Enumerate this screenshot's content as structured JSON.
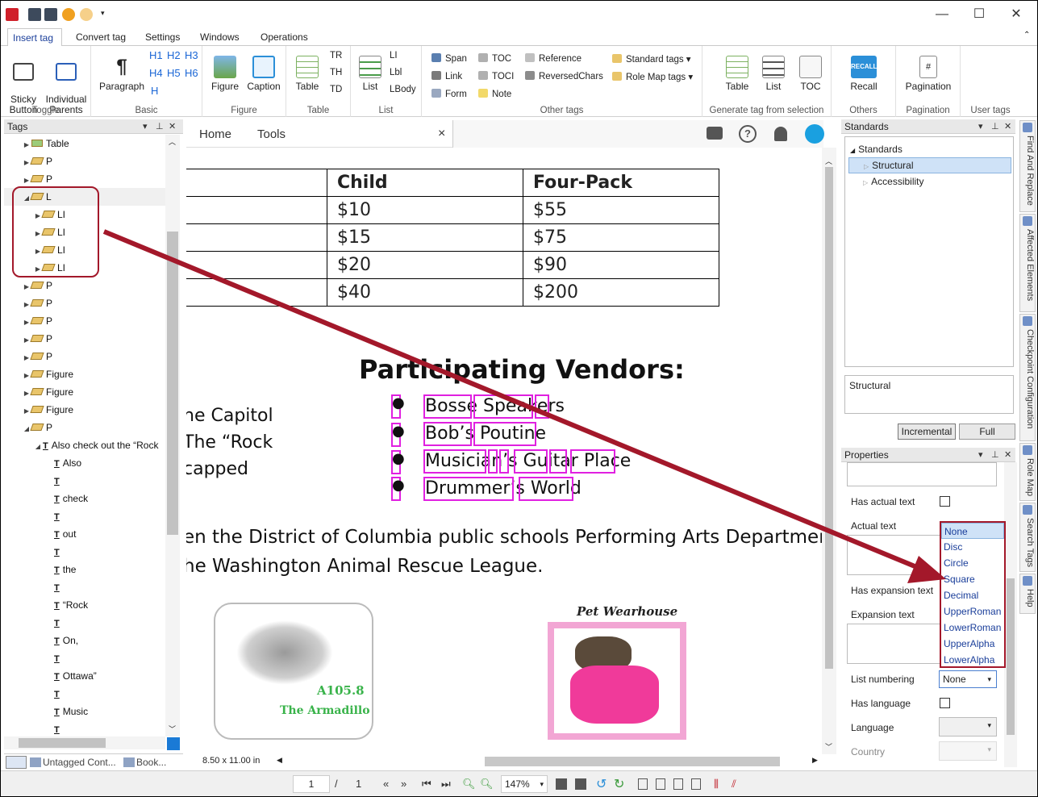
{
  "qat": {
    "app_icon": "pdf-app-icon",
    "icons": [
      "save-icon",
      "save-all-icon",
      "undo-icon",
      "redo-icon"
    ]
  },
  "window": {
    "minimize": "—",
    "maximize": "☐",
    "close": "✕"
  },
  "tabs": [
    "Insert tag",
    "Convert tag",
    "Settings",
    "Windows",
    "Operations"
  ],
  "ribbon": {
    "toggle": {
      "sticky": "Sticky\nButton",
      "individual": "Individual\nParents",
      "label": "Toggle"
    },
    "basic": {
      "paragraph": "Paragraph",
      "h1": "H1",
      "h2": "H2",
      "h3": "H3",
      "h4": "H4",
      "h5": "H5",
      "h6": "H6",
      "h": "H",
      "label": "Basic"
    },
    "figure": {
      "figure": "Figure",
      "caption": "Caption",
      "label": "Figure"
    },
    "table": {
      "table": "Table",
      "tr": "TR",
      "th": "TH",
      "td": "TD",
      "label": "Table"
    },
    "list": {
      "list": "List",
      "li": "LI",
      "lbl": "Lbl",
      "lbody": "LBody",
      "label": "List"
    },
    "other": {
      "span": "Span",
      "link": "Link",
      "form": "Form",
      "toc": "TOC",
      "toci": "TOCI",
      "note": "Note",
      "reference": "Reference",
      "reversed": "ReversedChars",
      "standard": "Standard tags",
      "rolemap": "Role Map tags",
      "label": "Other tags"
    },
    "generate": {
      "table": "Table",
      "list": "List",
      "toc": "TOC",
      "label": "Generate tag from selection"
    },
    "others": {
      "recall": "Recall",
      "recall_logo": "RECALL",
      "label": "Others"
    },
    "pagination": {
      "btn": "Pagination",
      "label": "Pagination"
    },
    "usertags": {
      "label": "User tags"
    }
  },
  "tags_panel": {
    "title": "Tags",
    "rows": [
      {
        "indent": 0,
        "tri": "▶",
        "icon": "table",
        "label": "Table"
      },
      {
        "indent": 0,
        "tri": "▶",
        "icon": "tag",
        "label": "P"
      },
      {
        "indent": 0,
        "tri": "▶",
        "icon": "tag",
        "label": "P"
      },
      {
        "indent": 0,
        "tri": "◢",
        "icon": "tag",
        "label": "L"
      },
      {
        "indent": 1,
        "tri": "▶",
        "icon": "tag",
        "label": "LI"
      },
      {
        "indent": 1,
        "tri": "▶",
        "icon": "tag",
        "label": "LI"
      },
      {
        "indent": 1,
        "tri": "▶",
        "icon": "tag",
        "label": "LI"
      },
      {
        "indent": 1,
        "tri": "▶",
        "icon": "tag",
        "label": "LI"
      },
      {
        "indent": 0,
        "tri": "▶",
        "icon": "tag",
        "label": "P"
      },
      {
        "indent": 0,
        "tri": "▶",
        "icon": "tag",
        "label": "P"
      },
      {
        "indent": 0,
        "tri": "▶",
        "icon": "tag",
        "label": "P"
      },
      {
        "indent": 0,
        "tri": "▶",
        "icon": "tag",
        "label": "P"
      },
      {
        "indent": 0,
        "tri": "▶",
        "icon": "tag",
        "label": "P"
      },
      {
        "indent": 0,
        "tri": "▶",
        "icon": "tag",
        "label": "Figure"
      },
      {
        "indent": 0,
        "tri": "▶",
        "icon": "tag",
        "label": "Figure"
      },
      {
        "indent": 0,
        "tri": "▶",
        "icon": "tag",
        "label": "Figure"
      },
      {
        "indent": 0,
        "tri": "◢",
        "icon": "tag",
        "label": "P"
      },
      {
        "indent": 1,
        "tri": "◢",
        "icon": "text",
        "label": "Also check out the “Rock"
      },
      {
        "indent": 2,
        "tri": "",
        "icon": "text",
        "label": "Also"
      },
      {
        "indent": 2,
        "tri": "",
        "icon": "text",
        "label": ""
      },
      {
        "indent": 2,
        "tri": "",
        "icon": "text",
        "label": "check"
      },
      {
        "indent": 2,
        "tri": "",
        "icon": "text",
        "label": ""
      },
      {
        "indent": 2,
        "tri": "",
        "icon": "text",
        "label": "out"
      },
      {
        "indent": 2,
        "tri": "",
        "icon": "text",
        "label": ""
      },
      {
        "indent": 2,
        "tri": "",
        "icon": "text",
        "label": "the"
      },
      {
        "indent": 2,
        "tri": "",
        "icon": "text",
        "label": ""
      },
      {
        "indent": 2,
        "tri": "",
        "icon": "text",
        "label": "“Rock"
      },
      {
        "indent": 2,
        "tri": "",
        "icon": "text",
        "label": ""
      },
      {
        "indent": 2,
        "tri": "",
        "icon": "text",
        "label": "On,"
      },
      {
        "indent": 2,
        "tri": "",
        "icon": "text",
        "label": ""
      },
      {
        "indent": 2,
        "tri": "",
        "icon": "text",
        "label": "Ottawa”"
      },
      {
        "indent": 2,
        "tri": "",
        "icon": "text",
        "label": ""
      },
      {
        "indent": 2,
        "tri": "",
        "icon": "text",
        "label": "Music"
      },
      {
        "indent": 2,
        "tri": "",
        "icon": "text",
        "label": ""
      }
    ],
    "bottom_tabs": [
      "Untagged Cont...",
      "Book..."
    ]
  },
  "doc_tabs": {
    "home": "Home",
    "tools": "Tools",
    "close": "×"
  },
  "document": {
    "table_rows": [
      [
        ":",
        "Child",
        "Four-Pack"
      ],
      [
        "",
        "$10",
        "$55"
      ],
      [
        "",
        "$15",
        "$75"
      ],
      [
        "",
        "$20",
        "$90"
      ],
      [
        "",
        "$40",
        "$200"
      ]
    ],
    "heading": "Participating Vendors:",
    "left_lines": [
      "he Capitol",
      "The “Rock",
      "capped"
    ],
    "vendors": [
      "Bosse Speakers",
      "Bob’s Poutine",
      "Musician’s Guitar Place",
      "Drummer’s World"
    ],
    "bullet": "●",
    "para1": "en the District of Columbia public schools Performing Arts Department",
    "para2": "he Washington Animal Rescue League.",
    "logo1": [
      "A105.8",
      "The Armadillo"
    ],
    "logo2": "Pet Wearhouse",
    "page_size": "8.50 x 11.00 in"
  },
  "standards": {
    "title": "Standards",
    "root": "Standards",
    "items": [
      "Structural",
      "Accessibility"
    ],
    "description": "Structural",
    "incremental": "Incremental",
    "full": "Full"
  },
  "properties": {
    "title": "Properties",
    "has_actual_text": "Has actual text",
    "actual_text": "Actual text",
    "has_expansion": "Has expansion text",
    "expansion_text": "Expansion text",
    "list_numbering": "List numbering",
    "list_numbering_value": "None",
    "has_language": "Has language",
    "language": "Language",
    "country": "Country"
  },
  "dropdown": {
    "options": [
      "None",
      "Disc",
      "Circle",
      "Square",
      "Decimal",
      "UpperRoman",
      "LowerRoman",
      "UpperAlpha",
      "LowerAlpha"
    ],
    "selected": "None"
  },
  "side_tabs": [
    "Find And Replace",
    "Affected Elements",
    "Checkpoint Configuration",
    "Role Map",
    "Search Tags",
    "Help"
  ],
  "nav": {
    "page": "1",
    "sep": "/",
    "total": "1",
    "zoom": "147%"
  },
  "colors": {
    "accent": "#2b5fb8",
    "annotation": "#a3182a",
    "highlight": "#e020e0"
  }
}
